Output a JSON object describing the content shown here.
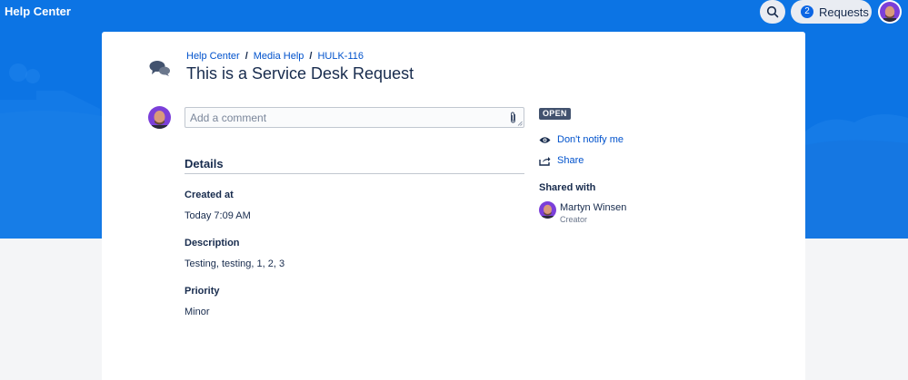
{
  "header": {
    "brand": "Help Center",
    "requests_count": "2",
    "requests_label": "Requests"
  },
  "breadcrumb": {
    "items": [
      "Help Center",
      "Media Help",
      "HULK-116"
    ],
    "separator": "/"
  },
  "request": {
    "title": "This is a Service Desk Request",
    "status": "OPEN"
  },
  "comment": {
    "placeholder": "Add a comment"
  },
  "details": {
    "heading": "Details",
    "fields": [
      {
        "label": "Created at",
        "value": "Today 7:09 AM"
      },
      {
        "label": "Description",
        "value": "Testing, testing, 1, 2, 3"
      },
      {
        "label": "Priority",
        "value": "Minor"
      }
    ]
  },
  "sidebar": {
    "notify_label": "Don't notify me",
    "share_label": "Share",
    "shared_with_heading": "Shared with",
    "shared_user": {
      "name": "Martyn Winsen",
      "role": "Creator"
    }
  },
  "colors": {
    "hero": "#0c74e4",
    "link": "#0052cc",
    "text": "#172b4d",
    "lozenge": "#42526e"
  },
  "icons": {
    "search": "search-icon",
    "chat": "chat-bubbles-icon",
    "attach": "paperclip-icon",
    "eye": "eye-icon",
    "share": "share-icon"
  }
}
